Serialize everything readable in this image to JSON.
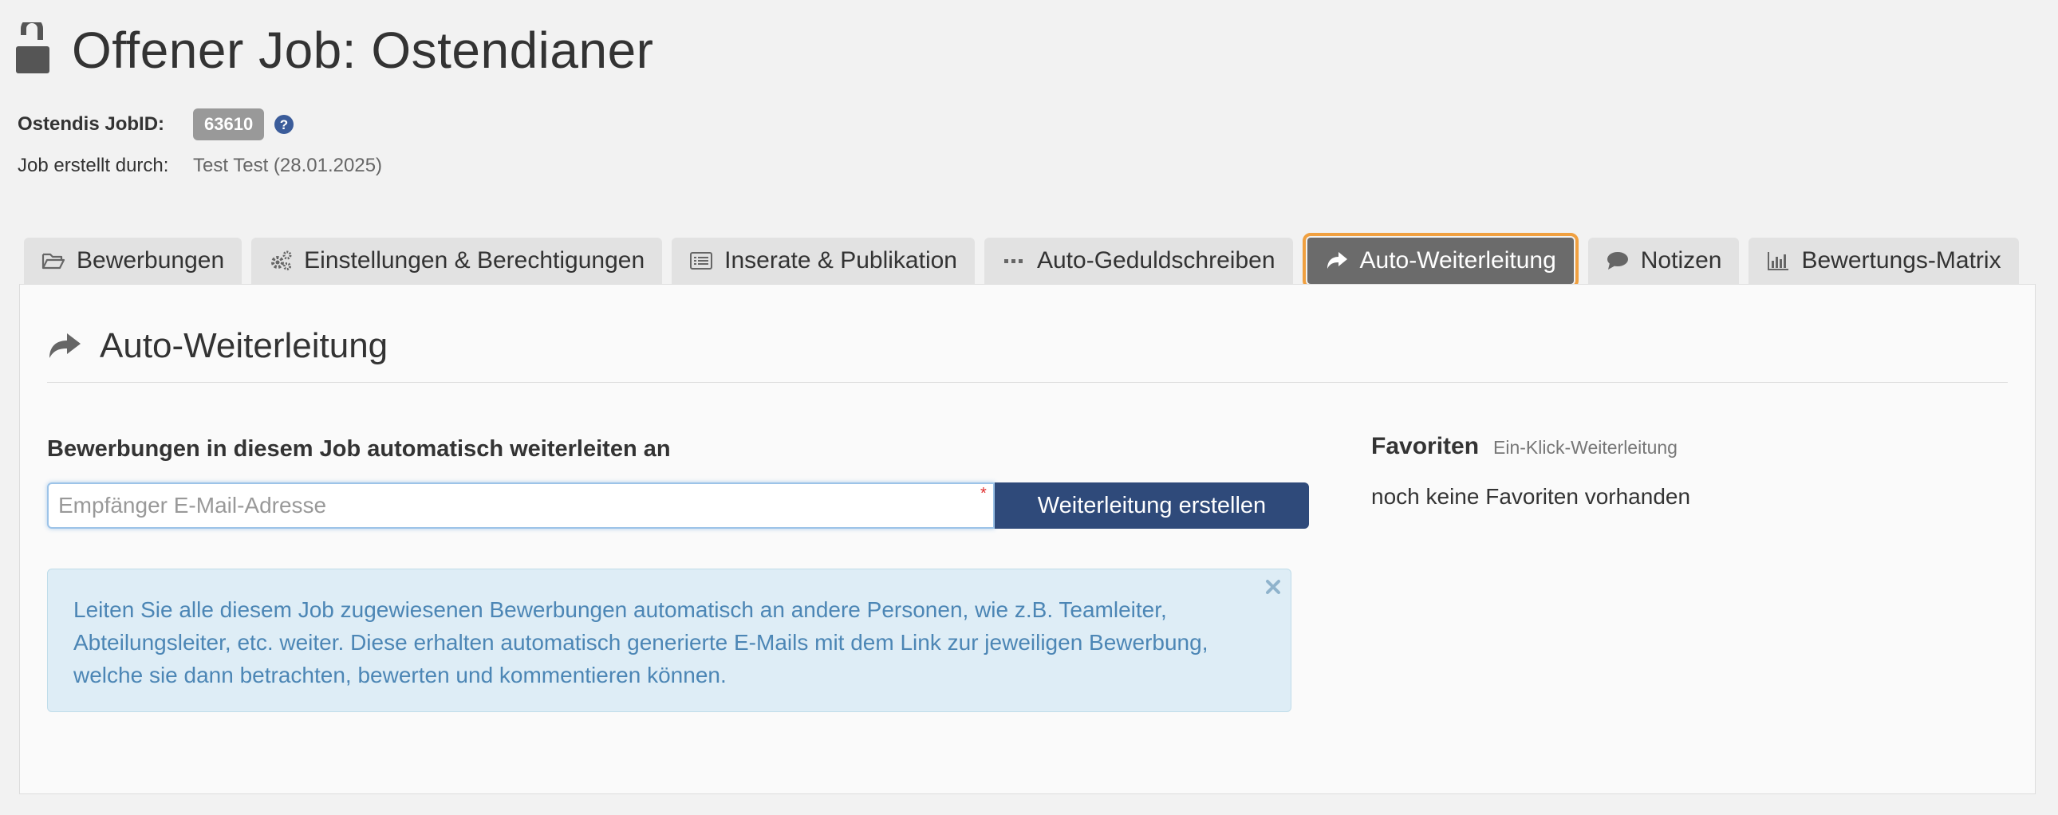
{
  "header": {
    "title": "Offener Job: Ostendianer"
  },
  "meta": {
    "jobid_label": "Ostendis JobID:",
    "jobid_value": "63610",
    "created_by_label": "Job erstellt durch:",
    "created_by_value": "Test Test (28.01.2025)"
  },
  "tabs": [
    {
      "label": "Bewerbungen",
      "icon": "folder-open-icon"
    },
    {
      "label": "Einstellungen & Berechtigungen",
      "icon": "gears-icon"
    },
    {
      "label": "Inserate & Publikation",
      "icon": "list-icon"
    },
    {
      "label": "Auto-Geduldschreiben",
      "icon": "ellipsis-icon"
    },
    {
      "label": "Auto-Weiterleitung",
      "icon": "share-icon",
      "active": true
    },
    {
      "label": "Notizen",
      "icon": "comment-icon"
    },
    {
      "label": "Bewertungs-Matrix",
      "icon": "bar-chart-icon"
    }
  ],
  "panel": {
    "title": "Auto-Weiterleitung",
    "form_label": "Bewerbungen in diesem Job automatisch weiterleiten an",
    "email_placeholder": "Empfänger E-Mail-Adresse",
    "submit_label": "Weiterleitung erstellen",
    "info_text": "Leiten Sie alle diesem Job zugewiesenen Bewerbungen automatisch an andere Personen, wie z.B. Teamleiter, Abteilungsleiter, etc. weiter. Diese erhalten automatisch generierte E-Mails mit dem Link zur jeweiligen Bewerbung, welche sie dann betrachten, bewerten und kommentieren können."
  },
  "favorites": {
    "title": "Favoriten",
    "subtitle": "Ein-Klick-Weiterleitung",
    "empty_text": "noch keine Favoriten vorhanden"
  },
  "colors": {
    "primary_button": "#2f4a7a",
    "active_tab": "#6b6b6b",
    "active_tab_outline": "#f0a040",
    "info_background": "#deedf6",
    "info_text": "#4c86b5"
  }
}
